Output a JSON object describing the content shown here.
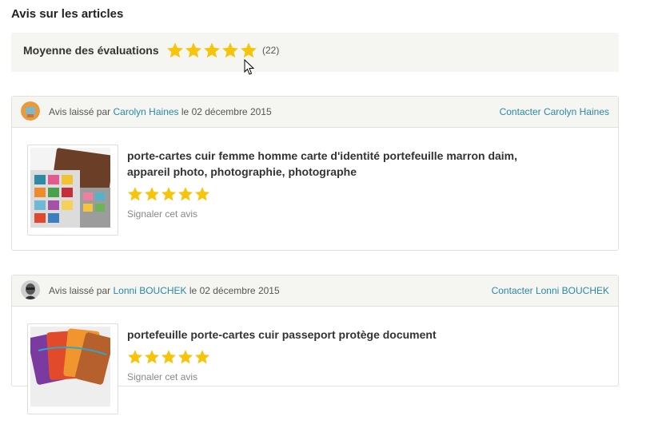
{
  "page": {
    "title": "Avis sur les articles"
  },
  "average": {
    "label": "Moyenne des évaluations",
    "stars": 5,
    "count": "(22)"
  },
  "reviews": [
    {
      "prefix": "Avis laissé par",
      "author": "Carolyn Haines",
      "date_text": "le 02 décembre 2015",
      "contact": "Contacter Carolyn Haines",
      "item_title": "porte-cartes cuir femme homme carte d'identité portefeuille marron daim, appareil photo, photographie, photographe",
      "stars": 5,
      "report": "Signaler cet avis"
    },
    {
      "prefix": "Avis laissé par",
      "author": "Lonni BOUCHEK",
      "date_text": "le 02 décembre 2015",
      "contact": "Contacter Lonni BOUCHEK",
      "item_title": "portefeuille porte-cartes cuir passeport protège document",
      "stars": 5,
      "report": "Signaler cet avis"
    }
  ],
  "colors": {
    "star": "#f5c40b",
    "link": "#2a88a8",
    "panel": "#f5f5f1"
  }
}
